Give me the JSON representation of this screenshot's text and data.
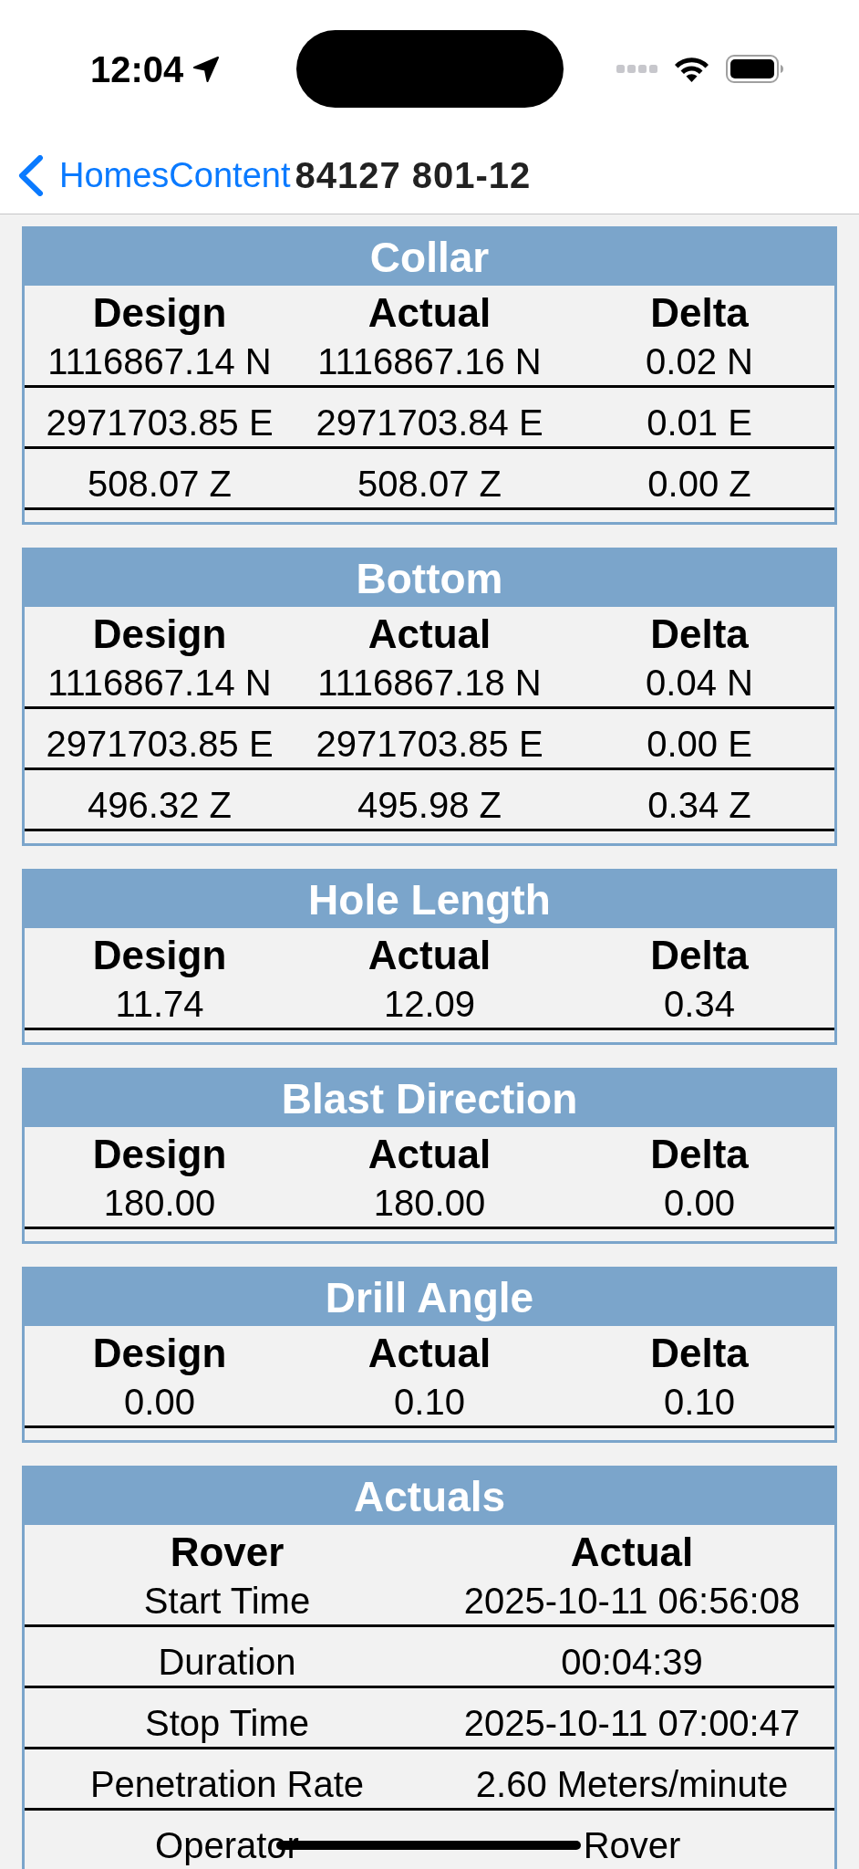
{
  "status_bar": {
    "time": "12:04"
  },
  "nav_bar": {
    "back_label": "HomesContent",
    "title": "84127 801-12"
  },
  "sections": [
    {
      "title": "Collar",
      "columns": [
        "Design",
        "Actual",
        "Delta"
      ],
      "rows": [
        [
          "1116867.14 N",
          "1116867.16 N",
          "0.02 N"
        ],
        [
          "2971703.85 E",
          "2971703.84 E",
          "0.01 E"
        ],
        [
          "508.07 Z",
          "508.07 Z",
          "0.00 Z"
        ]
      ]
    },
    {
      "title": "Bottom",
      "columns": [
        "Design",
        "Actual",
        "Delta"
      ],
      "rows": [
        [
          "1116867.14 N",
          "1116867.18 N",
          "0.04 N"
        ],
        [
          "2971703.85 E",
          "2971703.85 E",
          "0.00 E"
        ],
        [
          "496.32 Z",
          "495.98 Z",
          "0.34 Z"
        ]
      ]
    },
    {
      "title": "Hole Length",
      "columns": [
        "Design",
        "Actual",
        "Delta"
      ],
      "rows": [
        [
          "11.74",
          "12.09",
          "0.34"
        ]
      ]
    },
    {
      "title": "Blast Direction",
      "columns": [
        "Design",
        "Actual",
        "Delta"
      ],
      "rows": [
        [
          "180.00",
          "180.00",
          "0.00"
        ]
      ]
    },
    {
      "title": "Drill Angle",
      "columns": [
        "Design",
        "Actual",
        "Delta"
      ],
      "rows": [
        [
          "0.00",
          "0.10",
          "0.10"
        ]
      ]
    },
    {
      "title": "Actuals",
      "columns": [
        "Rover",
        "Actual"
      ],
      "rows": [
        [
          "Start Time",
          "2025-10-11 06:56:08"
        ],
        [
          "Duration",
          "00:04:39"
        ],
        [
          "Stop Time",
          "2025-10-11 07:00:47"
        ],
        [
          "Penetration Rate",
          "2.60 Meters/minute"
        ],
        [
          "Operator",
          "Rover"
        ]
      ]
    }
  ]
}
